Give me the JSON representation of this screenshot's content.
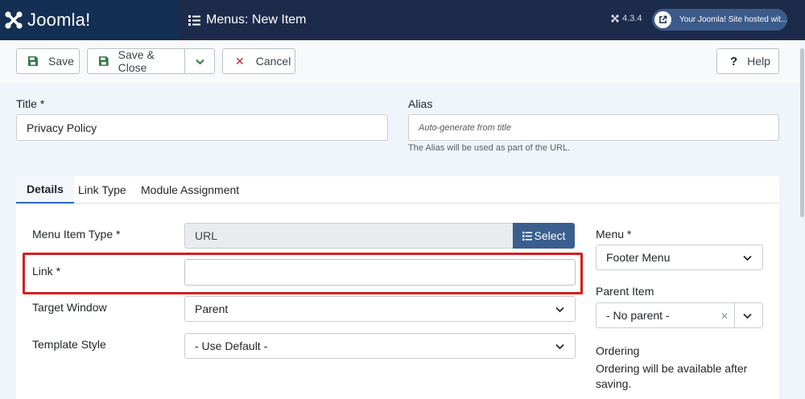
{
  "header": {
    "brand": "Joomla!",
    "page_title": "Menus: New Item",
    "version": "4.3.4",
    "site_link": "Your Joomla! Site hosted wit..."
  },
  "toolbar": {
    "save_label": "Save",
    "save_close_label": "Save & Close",
    "cancel_label": "Cancel",
    "help_label": "Help"
  },
  "form": {
    "title_label": "Title *",
    "title_value": "Privacy Policy",
    "alias_label": "Alias",
    "alias_placeholder": "Auto-generate from title",
    "alias_help": "The Alias will be used as part of the URL."
  },
  "tabs": [
    {
      "label": "Details",
      "active": true
    },
    {
      "label": "Link Type",
      "active": false
    },
    {
      "label": "Module Assignment",
      "active": false
    }
  ],
  "details": {
    "menu_item_type_label": "Menu Item Type *",
    "menu_item_type_value": "URL",
    "select_button": "Select",
    "link_label": "Link *",
    "link_value": "",
    "target_window_label": "Target Window",
    "target_window_value": "Parent",
    "template_style_label": "Template Style",
    "template_style_value": "- Use Default -"
  },
  "sidebar": {
    "menu_label": "Menu *",
    "menu_value": "Footer Menu",
    "parent_item_label": "Parent Item",
    "parent_item_value": "- No parent -",
    "ordering_label": "Ordering",
    "ordering_note": "Ordering will be available after saving."
  },
  "colors": {
    "header_bg": "#1d2b4b",
    "brand_bg": "#132f53",
    "accent": "#3a5f8f",
    "highlight": "#d91e1e"
  }
}
